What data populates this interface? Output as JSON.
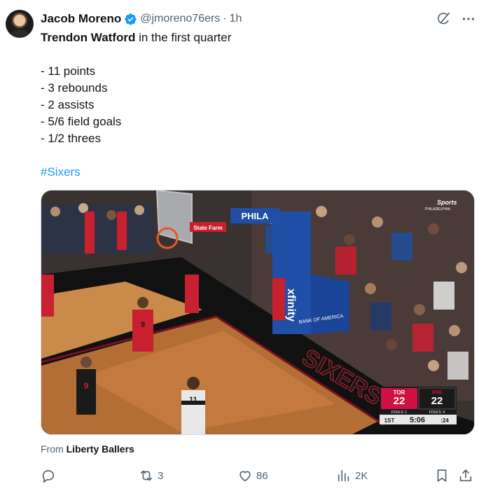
{
  "author": {
    "name": "Jacob Moreno",
    "handle": "@jmoreno76ers",
    "separator": "·",
    "time": "1h"
  },
  "tweet": {
    "headline_bold": "Trendon Watford",
    "headline_rest": " in the first quarter",
    "stats": [
      "- 11 points",
      "- 3 rebounds",
      "- 2 assists",
      "- 5/6 field goals",
      "- 1/2 threes"
    ],
    "hashtag": "#Sixers"
  },
  "media": {
    "network_logo": "Sports",
    "network_sub": "PHILADELPHIA",
    "backboard_text": "PHILA",
    "stanchion_text": "xfinity",
    "bank_text": "BANK OF AMERICA",
    "floor_text": "SIXERS",
    "sign_text": "State Farm",
    "players": {
      "p1_number": "9",
      "p2_number": "9",
      "ref_number": "11"
    },
    "scorebug": {
      "away_team": "TOR",
      "home_team": "PHI",
      "away_score": "22",
      "home_score": "22",
      "away_fouls": "FOULS: 1",
      "home_fouls": "FOULS: 4",
      "quarter": "1ST",
      "clock": "5:06",
      "shot_clock": ":24",
      "away_color": "#ce1141",
      "home_color": "#ce1141"
    }
  },
  "from": {
    "label": "From ",
    "source": "Liberty Ballers"
  },
  "actions": {
    "reply_count": "",
    "retweet_count": "3",
    "like_count": "86",
    "views_count": "2K"
  },
  "colors": {
    "accent": "#1d9bf0",
    "muted": "#536471",
    "text": "#0f1419"
  },
  "icons": [
    "verified-badge-icon",
    "grok-icon",
    "more-icon",
    "reply-icon",
    "retweet-icon",
    "like-icon",
    "views-icon",
    "bookmark-icon",
    "share-icon"
  ]
}
